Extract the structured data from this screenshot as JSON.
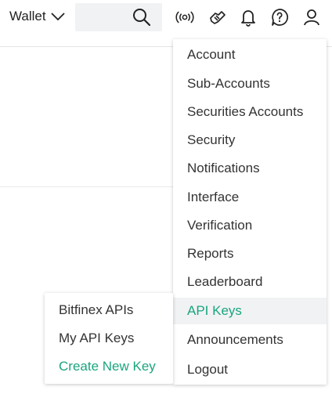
{
  "colors": {
    "accent": "#1aa57e",
    "text": "#333333",
    "hover_bg": "#f1f2f4"
  },
  "header": {
    "wallet_label": "Wallet",
    "wallet_icon": "chevron-down-icon",
    "search_icon": "search-icon",
    "icons": [
      "live-signal-icon",
      "handshake-icon",
      "bell-icon",
      "help-icon",
      "user-icon"
    ]
  },
  "account_menu": {
    "items": [
      {
        "label": "Account"
      },
      {
        "label": "Sub-Accounts"
      },
      {
        "label": "Securities Accounts"
      },
      {
        "label": "Security"
      },
      {
        "label": "Notifications"
      },
      {
        "label": "Interface"
      },
      {
        "label": "Verification"
      },
      {
        "label": "Reports"
      },
      {
        "label": "Leaderboard"
      },
      {
        "label": "API Keys",
        "active": true
      },
      {
        "label": "Announcements"
      },
      {
        "label": "Logout"
      }
    ]
  },
  "api_submenu": {
    "items": [
      {
        "label": "Bitfinex APIs"
      },
      {
        "label": "My API Keys"
      },
      {
        "label": "Create New Key",
        "accent": true
      }
    ]
  }
}
